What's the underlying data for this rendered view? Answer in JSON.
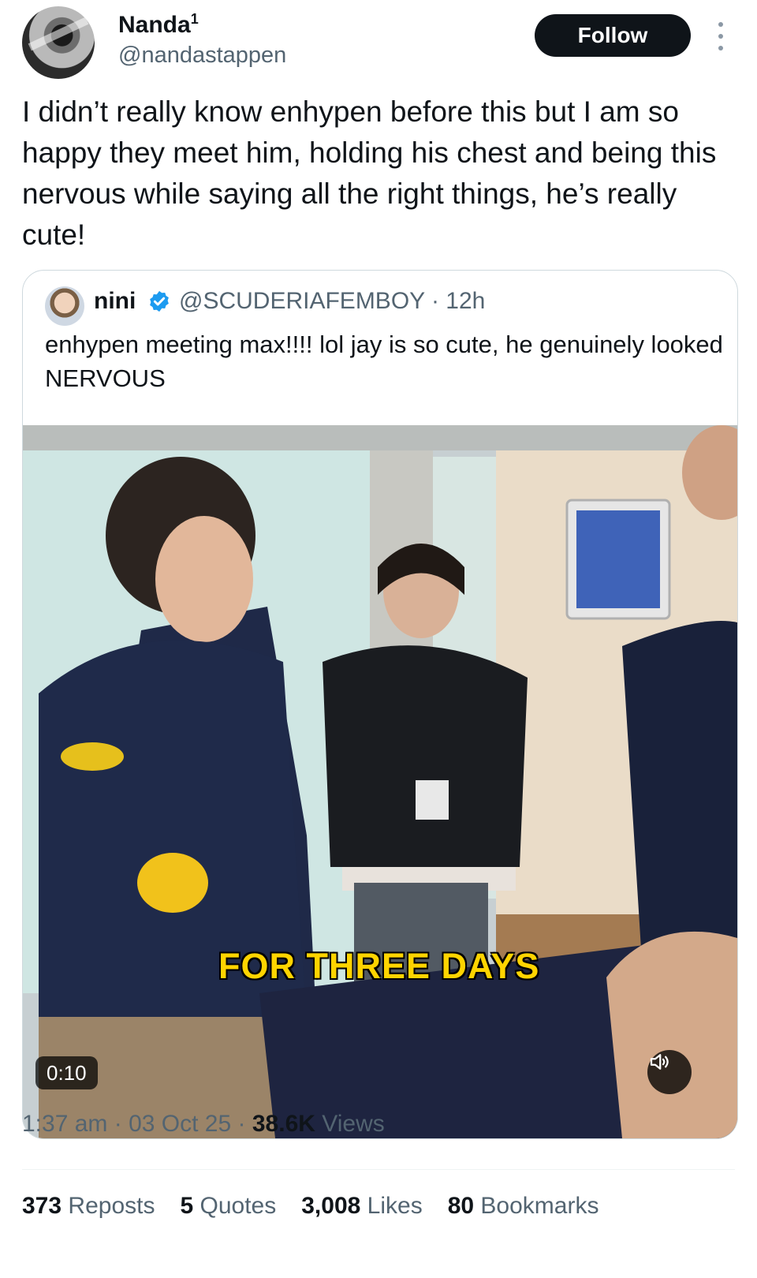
{
  "author": {
    "display_name": "Nanda",
    "name_superscript": "1",
    "handle": "@nandastappen",
    "avatar_icon": "profile-photo"
  },
  "follow_label": "Follow",
  "more_icon": "more-vertical-icon",
  "tweet_text": "I didn’t really know enhypen before this but I am so happy they meet him, holding his chest and being this nervous while saying all the right things, he’s really cute!",
  "quote": {
    "name": "nini",
    "verified_icon": "verified-badge-icon",
    "handle": "@SCUDERIAFEMBOY",
    "time": "· 12h",
    "text": "enhypen meeting max!!!! lol jay is so cute, he genuinely looked NERVOUS",
    "video": {
      "caption": "FOR THREE DAYS",
      "duration": "0:10",
      "mute_icon": "speaker-icon"
    }
  },
  "meta": {
    "time": "1:37 am",
    "sep1": "·",
    "date": "03 Oct 25",
    "sep2": "·",
    "views_count": "38.6K",
    "views_label": "Views"
  },
  "stats": [
    {
      "count": "373",
      "label": "Reposts"
    },
    {
      "count": "5",
      "label": "Quotes"
    },
    {
      "count": "3,008",
      "label": "Likes"
    },
    {
      "count": "80",
      "label": "Bookmarks"
    }
  ],
  "colors": {
    "text": "#0f1419",
    "secondary": "#536471",
    "verified": "#1d9bf0",
    "caption": "#ffd400"
  }
}
